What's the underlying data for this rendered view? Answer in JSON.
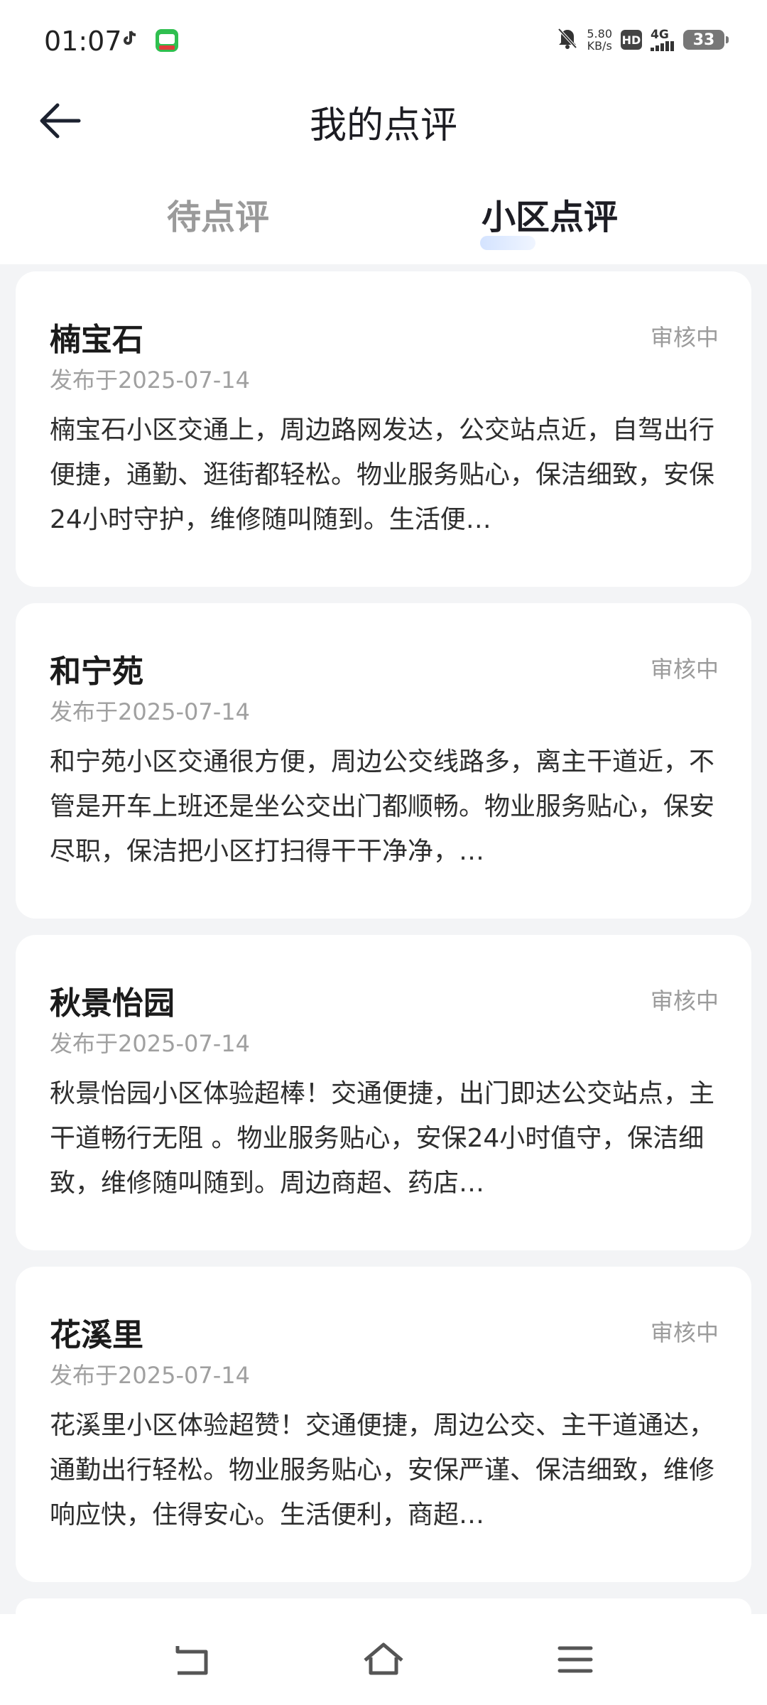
{
  "status_bar": {
    "time": "01:07",
    "speed_value": "5.80",
    "speed_unit": "KB/s",
    "hd": "HD",
    "network": "4G",
    "battery": "33"
  },
  "header": {
    "title": "我的点评"
  },
  "tabs": [
    {
      "label": "待点评",
      "active": false
    },
    {
      "label": "小区点评",
      "active": true
    }
  ],
  "reviews": [
    {
      "title": "楠宝石",
      "status": "审核中",
      "date": "发布于2025-07-14",
      "body": "楠宝石小区交通上，周边路网发达，公交站点近，自驾出行便捷，通勤、逛街都轻松。物业服务贴心，保洁细致，安保24小时守护，维修随叫随到。生活便…"
    },
    {
      "title": "和宁苑",
      "status": "审核中",
      "date": "发布于2025-07-14",
      "body": "和宁苑小区交通很方便，周边公交线路多，离主干道近，不管是开车上班还是坐公交出门都顺畅。物业服务贴心，保安尽职，保洁把小区打扫得干干净净，…"
    },
    {
      "title": "秋景怡园",
      "status": "审核中",
      "date": "发布于2025-07-14",
      "body": "秋景怡园小区体验超棒！交通便捷，出门即达公交站点，主干道畅行无阻 。物业服务贴心，安保24小时值守，保洁细致，维修随叫随到。周边商超、药店…"
    },
    {
      "title": "花溪里",
      "status": "审核中",
      "date": "发布于2025-07-14",
      "body": "花溪里小区体验超赞！交通便捷，周边公交、主干道通达，通勤出行轻松。物业服务贴心，安保严谨、保洁细致，维修响应快，住得安心。生活便利，商超…"
    }
  ],
  "nav": {
    "icons": [
      "back-gesture-icon",
      "home-icon",
      "menu-icon"
    ]
  }
}
